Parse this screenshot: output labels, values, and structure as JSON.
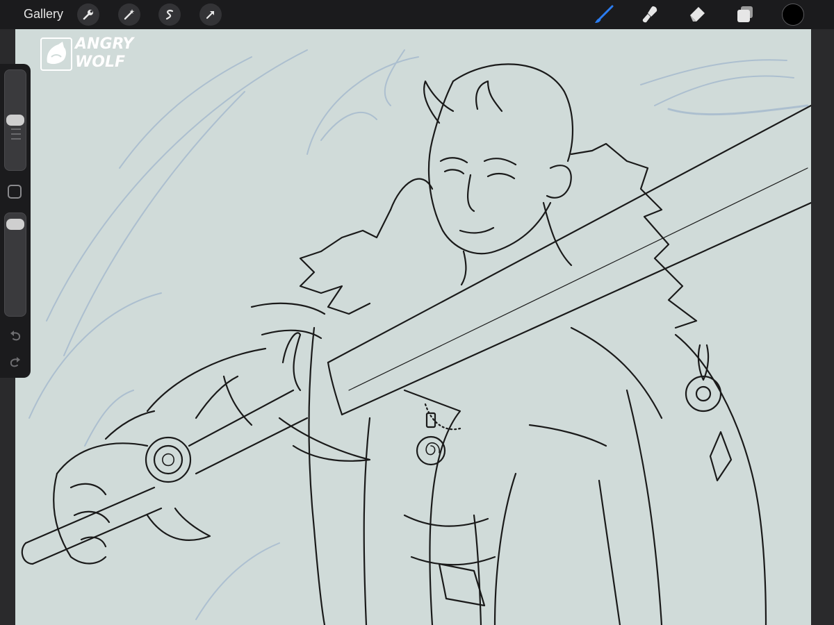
{
  "toolbar": {
    "gallery_label": "Gallery",
    "left_tools": [
      "wrench-icon",
      "magic-wand-icon",
      "selection-s-icon",
      "transform-arrow-icon"
    ],
    "right_tools": [
      "brush-icon",
      "smudge-icon",
      "eraser-icon",
      "layers-icon"
    ],
    "active_tool": "brush",
    "current_color": "#000000"
  },
  "canvas": {
    "background_color": "#d0dbd9",
    "watermark_line1": "ANGRY",
    "watermark_line2": "WOLF"
  },
  "sidebar": {
    "brush_size_level": 0.5,
    "opacity_level": 0.95
  }
}
